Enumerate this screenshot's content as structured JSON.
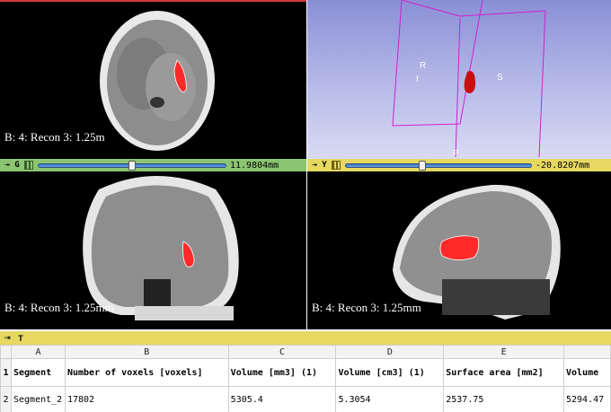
{
  "views": {
    "axial": {
      "label": "B: 4: Recon 3: 1.25m"
    },
    "three_d": {
      "orientation_markers": [
        "R",
        "I",
        "S",
        "P"
      ]
    },
    "coronal": {
      "label": "B: 4: Recon 3: 1.25mm"
    },
    "sagittal": {
      "label": "B: 4: Recon 3: 1.25mm"
    }
  },
  "slice_controls": {
    "green": {
      "letter": "G",
      "offset": "11.9804mm",
      "slider_fraction": 0.5,
      "color": "#8cc572"
    },
    "yellow": {
      "letter": "Y",
      "offset": "-20.8207mm",
      "slider_fraction": 0.41,
      "color": "#e6d861"
    }
  },
  "table_view": {
    "letter": "T",
    "column_letters": [
      "A",
      "B",
      "C",
      "D",
      "E",
      ""
    ],
    "row_numbers": [
      "1",
      "2"
    ],
    "header_row": [
      "Segment",
      "Number of voxels [voxels]",
      "Volume [mm3] (1)",
      "Volume [cm3] (1)",
      "Surface area [mm2]",
      "Volume"
    ],
    "data_row": [
      "Segment_2",
      "17802",
      "5305.4",
      "5.3054",
      "2537.75",
      "5294.47"
    ]
  },
  "colors": {
    "segment": "#ff2a2a",
    "bbox": "#d020d0"
  }
}
